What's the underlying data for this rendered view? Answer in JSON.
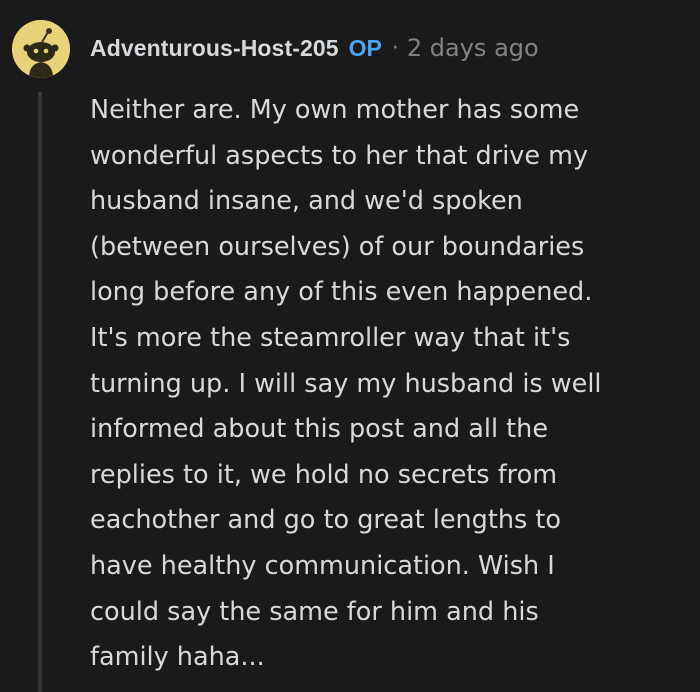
{
  "comment": {
    "username": "Adventurous-Host-205",
    "op_badge": "OP",
    "separator": "·",
    "timestamp": "2 days ago",
    "avatar_icon": "reddit-snoo-avatar-icon",
    "body_lines": [
      "Neither are. My own mother has some",
      "wonderful aspects to her that drive my",
      "husband insane, and we'd spoken",
      "(between ourselves) of our boundaries",
      "long before any of this even happened.",
      "It's more the steamroller way that it's",
      "turning up. I will say my husband is well",
      "informed about this post and all the",
      "replies to it, we hold no secrets from",
      "eachother and go to great lengths to",
      "have healthy communication. Wish I",
      "could say the same for him and his",
      "family haha..."
    ]
  },
  "colors": {
    "background": "#1a1a1b",
    "text": "#d7dadc",
    "muted": "#818384",
    "op_blue": "#4fa3f7",
    "thread_line": "#343536",
    "avatar_bg": "#e8d27a"
  }
}
